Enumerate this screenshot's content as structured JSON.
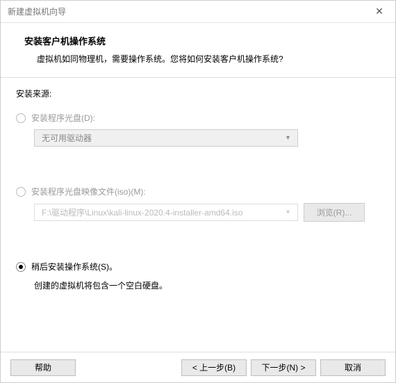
{
  "window": {
    "title": "新建虚拟机向导"
  },
  "header": {
    "title": "安装客户机操作系统",
    "subtitle": "虚拟机如同物理机，需要操作系统。您将如何安装客户机操作系统?"
  },
  "section_label": "安装来源:",
  "options": {
    "disc": {
      "label": "安装程序光盘(D):",
      "combo_text": "无可用驱动器"
    },
    "iso": {
      "label": "安装程序光盘映像文件(iso)(M):",
      "combo_text": "F:\\驱动程序\\Linux\\kali-linux-2020.4-installer-amd64.iso",
      "browse_label": "浏览(R)..."
    },
    "later": {
      "label": "稍后安装操作系统(S)。",
      "hint": "创建的虚拟机将包含一个空白硬盘。"
    }
  },
  "footer": {
    "help": "帮助",
    "back": "< 上一步(B)",
    "next": "下一步(N) >",
    "cancel": "取消"
  }
}
